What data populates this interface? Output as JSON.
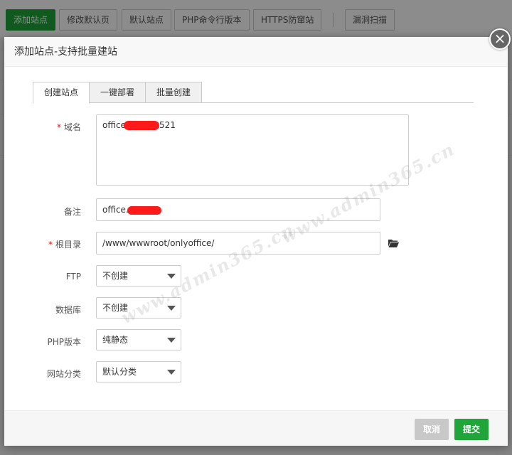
{
  "toolbar": {
    "buttons": [
      "添加站点",
      "修改默认页",
      "默认站点",
      "PHP命令行版本",
      "HTTPS防窜站",
      "漏洞扫描"
    ]
  },
  "dialog": {
    "title": "添加站点-支持批量建站",
    "close_label": "×",
    "tabs": [
      "创建站点",
      "一键部署",
      "批量创建"
    ],
    "form": {
      "domain": {
        "label": "域名",
        "required_mark": "*",
        "value_prefix": "office",
        "value_suffix": "521"
      },
      "remark": {
        "label": "备注",
        "value_prefix": "office."
      },
      "root": {
        "label": "根目录",
        "required_mark": "*",
        "value": "/www/wwwroot/onlyoffice/"
      },
      "ftp": {
        "label": "FTP",
        "value": "不创建"
      },
      "database": {
        "label": "数据库",
        "value": "不创建"
      },
      "php": {
        "label": "PHP版本",
        "value": "纯静态"
      },
      "category": {
        "label": "网站分类",
        "value": "默认分类"
      }
    },
    "footer": {
      "cancel": "取消",
      "submit": "提交"
    }
  },
  "watermark": "www.admin365.cn",
  "colors": {
    "accent": "#20a53a",
    "required": "#ff0000",
    "redaction": "#ff1a1a"
  }
}
